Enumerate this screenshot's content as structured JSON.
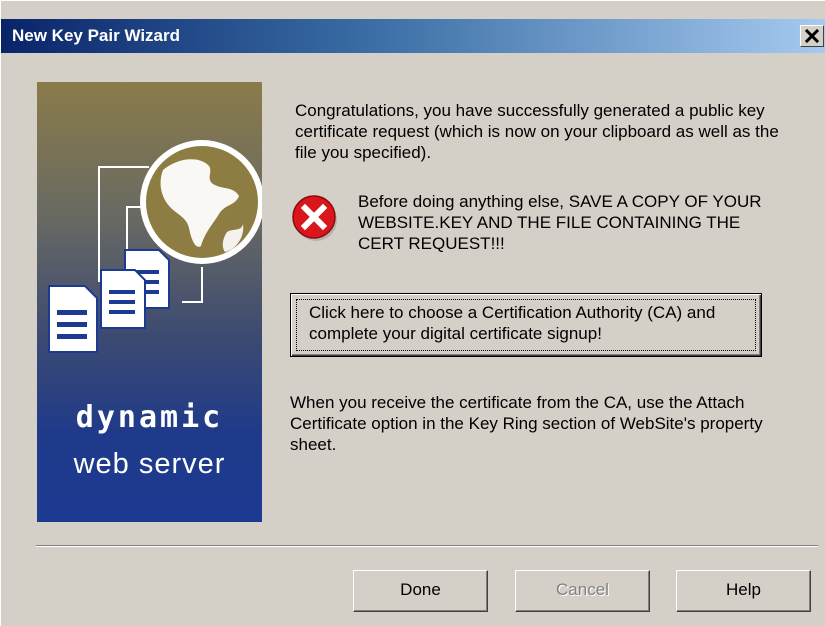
{
  "window": {
    "title": "New Key Pair Wizard",
    "close_glyph": "✕",
    "close_icon": "close-icon"
  },
  "banner": {
    "line1": "dynamic",
    "line2": "web server",
    "icons": [
      "globe-icon",
      "documents-icon"
    ]
  },
  "content": {
    "intro": "Congratulations, you have successfully generated a public key certificate request (which is now on your clipboard as well as the file you specified).",
    "warning_icon": "error-icon",
    "warning": "Before doing anything else, SAVE A COPY OF YOUR WEBSITE.KEY AND THE FILE CONTAINING THE CERT REQUEST!!!",
    "ca_button_label": "Click here to choose a Certification Authority (CA) and complete your digital certificate signup!",
    "outro": "When you receive the certificate from the CA, use the Attach Certificate option in the Key Ring section of WebSite's property sheet."
  },
  "buttons": {
    "done": "Done",
    "cancel": "Cancel",
    "help": "Help"
  },
  "colors": {
    "title_bar_start": "#0a246a",
    "title_bar_end": "#a6caf0",
    "dialog_face": "#d4d0c8",
    "error_red": "#d8161c"
  }
}
